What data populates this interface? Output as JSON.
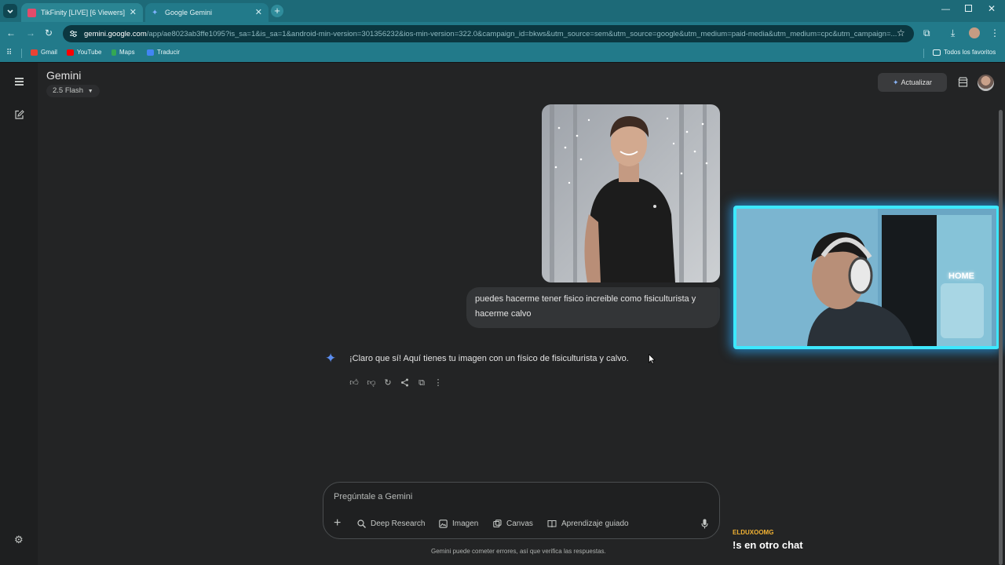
{
  "browser": {
    "tabs": [
      {
        "title": "TikFinity [LIVE] [6 Viewers]",
        "favicon_color": "#e34b6b"
      },
      {
        "title": "Google Gemini",
        "favicon_color": "#4c8df6"
      }
    ],
    "url_host": "gemini.google.com",
    "url_path": "/app/ae8023ab3ffe1095?is_sa=1&is_sa=1&android-min-version=301356232&ios-min-version=322.0&campaign_id=bkws&utm_source=sem&utm_source=google&utm_medium=paid-media&utm_medium=cpc&utm_campaign=...",
    "bookmarks": [
      {
        "label": "Gmail",
        "icon": "gmail-icon",
        "color": "#ea4335"
      },
      {
        "label": "YouTube",
        "icon": "youtube-icon",
        "color": "#ff0000"
      },
      {
        "label": "Maps",
        "icon": "maps-icon",
        "color": "#34a853"
      },
      {
        "label": "Traducir",
        "icon": "translate-icon",
        "color": "#4285f4"
      }
    ],
    "all_bookmarks": "Todos los favoritos"
  },
  "gemini": {
    "title": "Gemini",
    "model": "2.5 Flash",
    "upgrade_label": "Actualizar",
    "user_prompt": "puedes hacerme tener fisico increible como fisiculturista y hacerme calvo",
    "response": "¡Claro que sí! Aquí tienes tu imagen con un físico de fisiculturista y calvo.",
    "composer_placeholder": "Pregúntale a Gemini",
    "tools": [
      "Deep Research",
      "Imagen",
      "Canvas",
      "Aprendizaje guiado"
    ],
    "disclaimer": "Gemini puede cometer errores, así que verifica las respuestas."
  },
  "overlay": {
    "webcam_sign": "HOME",
    "chat_user": "ELDUXOOMG",
    "chat_message": "!s en otro chat"
  }
}
